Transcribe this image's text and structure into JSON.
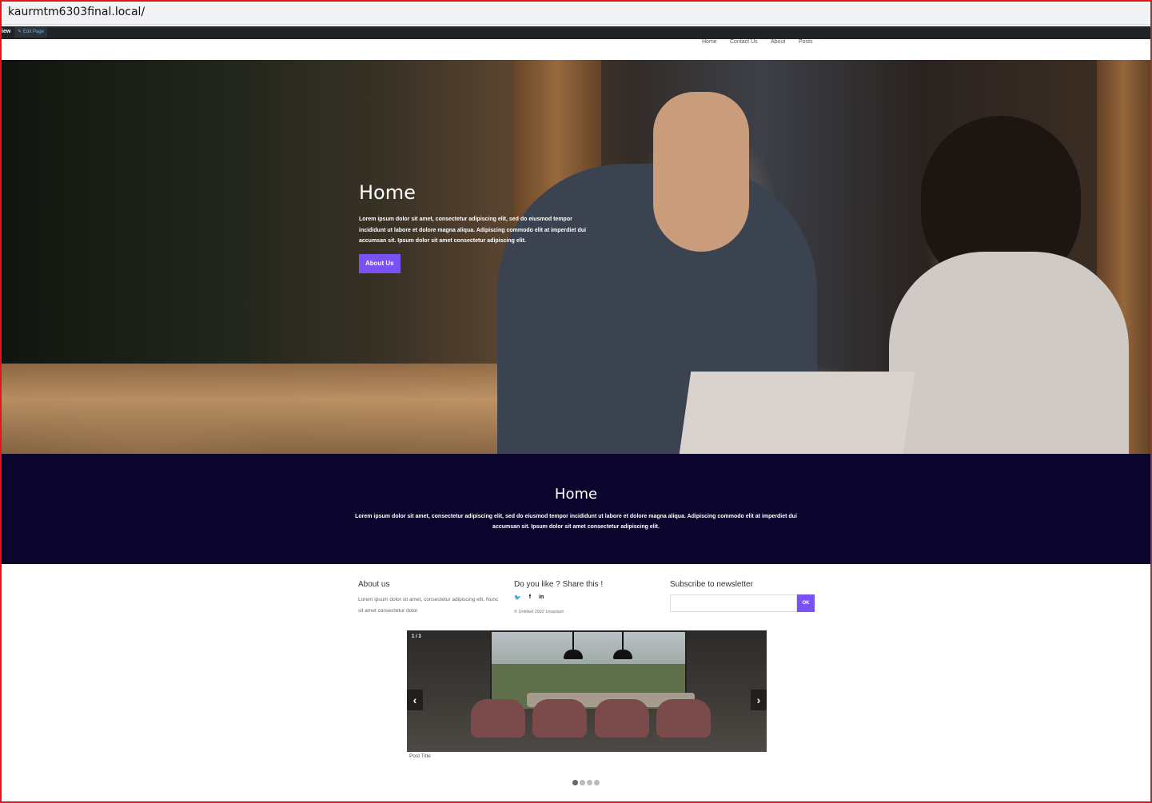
{
  "browser": {
    "url": "kaurmtm6303final.local/"
  },
  "admin_bar": {
    "view_label": "iew",
    "edit_label": "Edit Page"
  },
  "nav": {
    "items": [
      "Home",
      "Contact Us",
      "About",
      "Posts"
    ]
  },
  "hero": {
    "title": "Home",
    "text": "Lorem ipsum dolor sit amet, consectetur adipiscing elit, sed do eiusmod tempor incididunt ut labore et dolore magna aliqua. Adipiscing commodo elit at imperdiet dui accumsan sit. Ipsum dolor sit amet consectetur adipiscing elit.",
    "button_label": "About Us"
  },
  "band": {
    "title": "Home",
    "text": "Lorem ipsum dolor sit amet, consectetur adipiscing elit, sed do eiusmod tempor incididunt ut labore et dolore magna aliqua. Adipiscing commodo elit at imperdiet dui accumsan sit. Ipsum dolor sit amet consectetur adipiscing elit."
  },
  "footer": {
    "about": {
      "title": "About us",
      "text": "Lorem ipsum dolor sit amet, consectetur adipiscing elit. Nunc sit amet consectetur dolor"
    },
    "share": {
      "title": "Do you like ? Share this !",
      "icons": [
        "twitter-icon",
        "facebook-icon",
        "linkedin-icon"
      ],
      "copyright": "© Untitled 2022 Unsplash"
    },
    "newsletter": {
      "title": "Subscribe to newsletter",
      "placeholder": "",
      "button_label": "OK"
    }
  },
  "slider": {
    "counter": "1 / 3",
    "prev_label": "‹",
    "next_label": "›",
    "caption": "Post Title",
    "dot_count": 4,
    "active_dot": 0
  },
  "colors": {
    "accent": "#7a52f4",
    "band_bg": "#0b052e",
    "admin_bg": "#1d2327"
  }
}
